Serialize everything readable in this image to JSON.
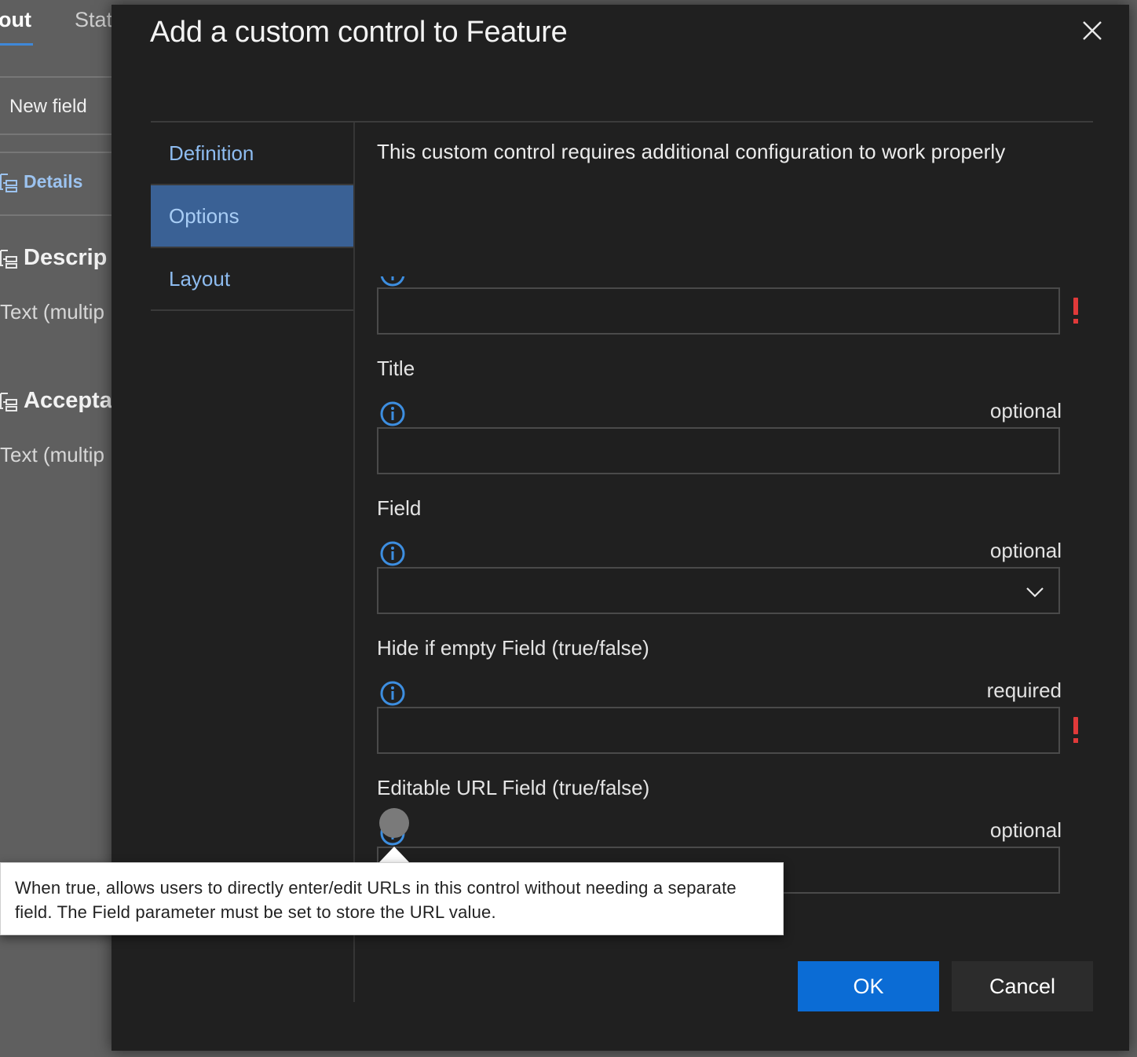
{
  "background": {
    "tabs": [
      "out",
      "Stat"
    ],
    "new_field": "New field",
    "details": "Details",
    "sections": [
      {
        "title": "Descrip",
        "type": "Text (multip"
      },
      {
        "title": "Accepta",
        "type": "Text (multip"
      }
    ]
  },
  "dialog": {
    "title": "Add a custom control to Feature",
    "nav": [
      "Definition",
      "Options",
      "Layout"
    ],
    "intro": "This custom control requires additional configuration to work properly",
    "fields": [
      {
        "label": "Title",
        "status": "optional"
      },
      {
        "label": "Field",
        "status": "optional"
      },
      {
        "label": "Hide if empty Field (true/false)",
        "status": "required"
      },
      {
        "label": "Editable URL Field (true/false)",
        "status": "optional"
      }
    ],
    "ok_label": "OK",
    "cancel_label": "Cancel"
  },
  "tooltip": {
    "text": "When true, allows users to directly enter/edit URLs in this control without needing a separate field. The Field parameter must be set to store the URL value."
  },
  "colors": {
    "accent": "#0b6cd5",
    "nav_active": "#3a6195",
    "link": "#8ebcf0",
    "error": "#e03a3a",
    "info": "#3d8ee0"
  },
  "icons": [
    "close-icon",
    "info-icon",
    "chevron-down-icon",
    "error-icon",
    "field-group-icon"
  ]
}
